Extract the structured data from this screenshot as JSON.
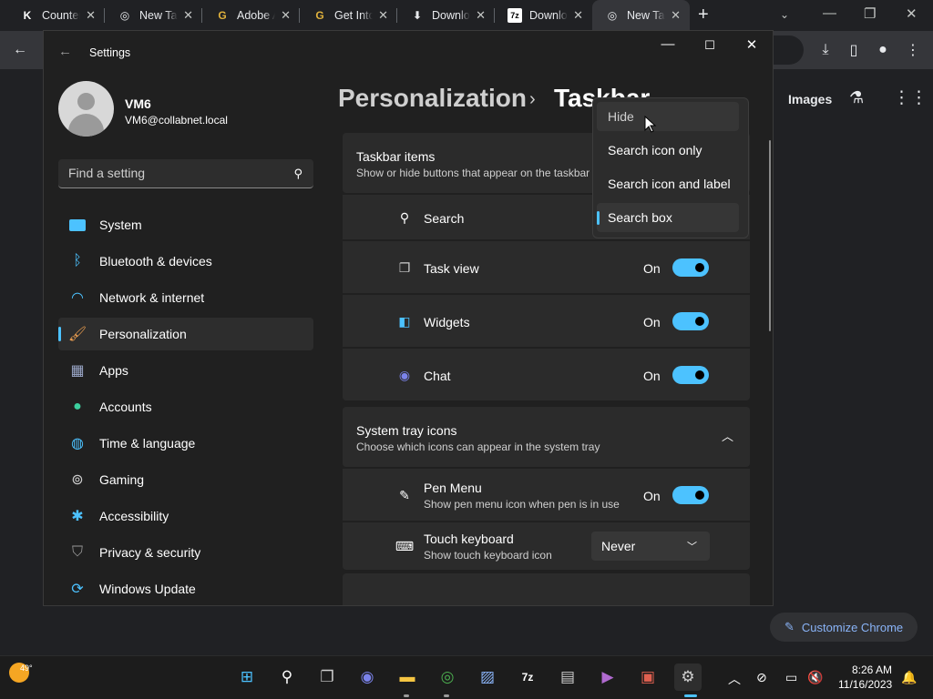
{
  "chrome": {
    "tabs": [
      {
        "label": "Counter",
        "icon": "K"
      },
      {
        "label": "New Tab",
        "icon": "◎"
      },
      {
        "label": "Adobe A",
        "icon": "G"
      },
      {
        "label": "Get Into",
        "icon": "G"
      },
      {
        "label": "Downloa",
        "icon": "⬇"
      },
      {
        "label": "Downloa",
        "icon": "7z"
      },
      {
        "label": "New Tab",
        "icon": "◎"
      }
    ],
    "new_tab": "+",
    "images_link": "Images",
    "customize_label": "Customize Chrome"
  },
  "settings": {
    "title": "Settings",
    "user": {
      "name": "VM6",
      "email": "VM6@collabnet.local"
    },
    "search_placeholder": "Find a setting",
    "nav": [
      {
        "label": "System",
        "icon": "system-icon"
      },
      {
        "label": "Bluetooth & devices",
        "icon": "bluetooth-icon"
      },
      {
        "label": "Network & internet",
        "icon": "wifi-icon"
      },
      {
        "label": "Personalization",
        "icon": "brush-icon",
        "selected": true
      },
      {
        "label": "Apps",
        "icon": "apps-icon"
      },
      {
        "label": "Accounts",
        "icon": "accounts-icon"
      },
      {
        "label": "Time & language",
        "icon": "globe-icon"
      },
      {
        "label": "Gaming",
        "icon": "gamepad-icon"
      },
      {
        "label": "Accessibility",
        "icon": "accessibility-icon"
      },
      {
        "label": "Privacy & security",
        "icon": "shield-icon"
      },
      {
        "label": "Windows Update",
        "icon": "update-icon"
      }
    ],
    "breadcrumb": {
      "parent": "Personalization",
      "separator": "›",
      "current": "Taskbar"
    },
    "taskbar_items": {
      "title": "Taskbar items",
      "subtitle": "Show or hide buttons that appear on the taskbar"
    },
    "rows": {
      "search": {
        "label": "Search"
      },
      "task_view": {
        "label": "Task view",
        "state": "On"
      },
      "widgets": {
        "label": "Widgets",
        "state": "On"
      },
      "chat": {
        "label": "Chat",
        "state": "On"
      }
    },
    "tray": {
      "title": "System tray icons",
      "subtitle": "Choose which icons can appear in the system tray"
    },
    "pen_menu": {
      "label": "Pen Menu",
      "sub": "Show pen menu icon when pen is in use",
      "state": "On"
    },
    "touch_keyboard": {
      "label": "Touch keyboard",
      "sub": "Show touch keyboard icon",
      "value": "Never"
    },
    "search_dropdown": {
      "options": [
        "Hide",
        "Search icon only",
        "Search icon and label",
        "Search box"
      ],
      "selected": "Search box",
      "hovered": "Hide"
    }
  },
  "taskbar": {
    "temperature": "49°",
    "time": "8:26 AM",
    "date": "11/16/2023"
  },
  "colors": {
    "accent": "#4cc2ff",
    "chrome_link": "#8ab4f8"
  }
}
